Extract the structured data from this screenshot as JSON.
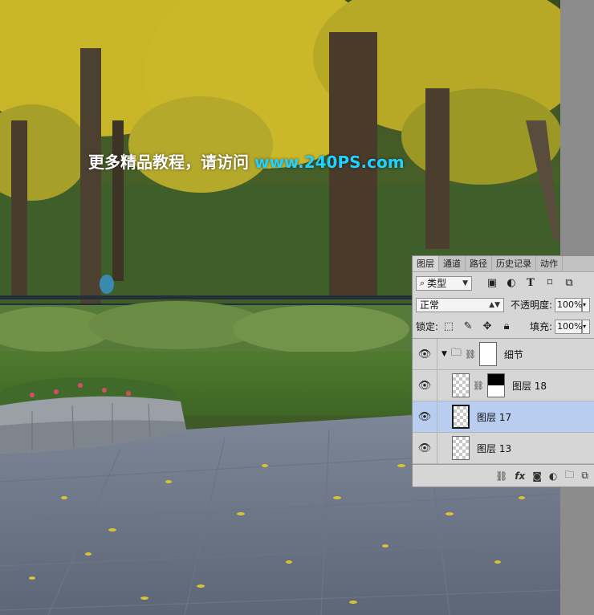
{
  "watermark": {
    "prefix": "更多精品教程，请访问 ",
    "url": "www.240PS.com"
  },
  "panel": {
    "tabs": [
      "图层",
      "通道",
      "路径",
      "历史记录",
      "动作"
    ],
    "filter": {
      "label": "类型"
    },
    "blend_mode": "正常",
    "opacity_label": "不透明度:",
    "opacity_value": "100%",
    "lock_label": "锁定:",
    "fill_label": "填充:",
    "fill_value": "100%",
    "layers": [
      {
        "name": "细节",
        "kind": "group"
      },
      {
        "name": "图层 18",
        "kind": "masked"
      },
      {
        "name": "图层 17",
        "kind": "pixel",
        "selected": true
      },
      {
        "name": "图层 13",
        "kind": "pixel"
      }
    ],
    "footer_fx": "fx"
  },
  "colors": {
    "selected_row": "#b9cdf0",
    "url_accent": "#1fd2ff"
  }
}
